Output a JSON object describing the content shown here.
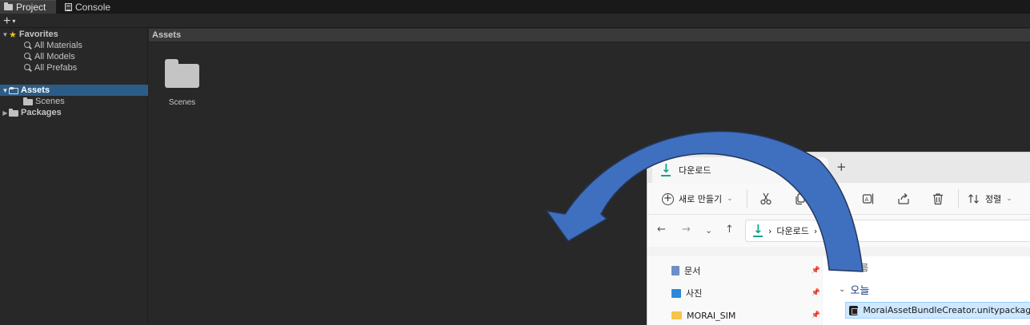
{
  "tabs": [
    {
      "label": "Project",
      "icon": "folder-icon",
      "active": true
    },
    {
      "label": "Console",
      "icon": "console-icon",
      "active": false
    }
  ],
  "toolbar": {
    "add_label": "+",
    "add_caret": "▾"
  },
  "tree": {
    "favorites": {
      "label": "Favorites",
      "items": [
        "All Materials",
        "All Models",
        "All Prefabs"
      ]
    },
    "assets": {
      "label": "Assets",
      "children": [
        "Scenes"
      ]
    },
    "packages": {
      "label": "Packages"
    }
  },
  "asset_panel": {
    "header": "Assets",
    "items": [
      {
        "label": "Scenes",
        "icon": "folder-icon"
      }
    ]
  },
  "explorer": {
    "tab_title": "다운로드",
    "tab_add": "+",
    "new_label": "새로 만들기",
    "new_caret": "⌄",
    "sort_label": "정렬",
    "sort_caret": "⌄",
    "nav": {
      "back": "←",
      "forward": "→",
      "down": "⌄",
      "up": "↑"
    },
    "address": {
      "chevron_left": "›",
      "path": "다운로드",
      "chevron_right": "›"
    },
    "sidebar": [
      {
        "label": "문서",
        "icon": "document-icon",
        "pin": "📌"
      },
      {
        "label": "사진",
        "icon": "picture-icon",
        "pin": "📌"
      },
      {
        "label": "MORAI_SIM",
        "icon": "folder-icon",
        "pin": "📌"
      }
    ],
    "list_header": "름",
    "group_caret": "⌄",
    "group": "오늘",
    "file": "MoraiAssetBundleCreator.unitypackage"
  },
  "colors": {
    "selection": "#2c5d87",
    "accent_arrow": "#3f6fbf",
    "favorite_star": "#f3c012",
    "download_teal": "#13a58b"
  }
}
